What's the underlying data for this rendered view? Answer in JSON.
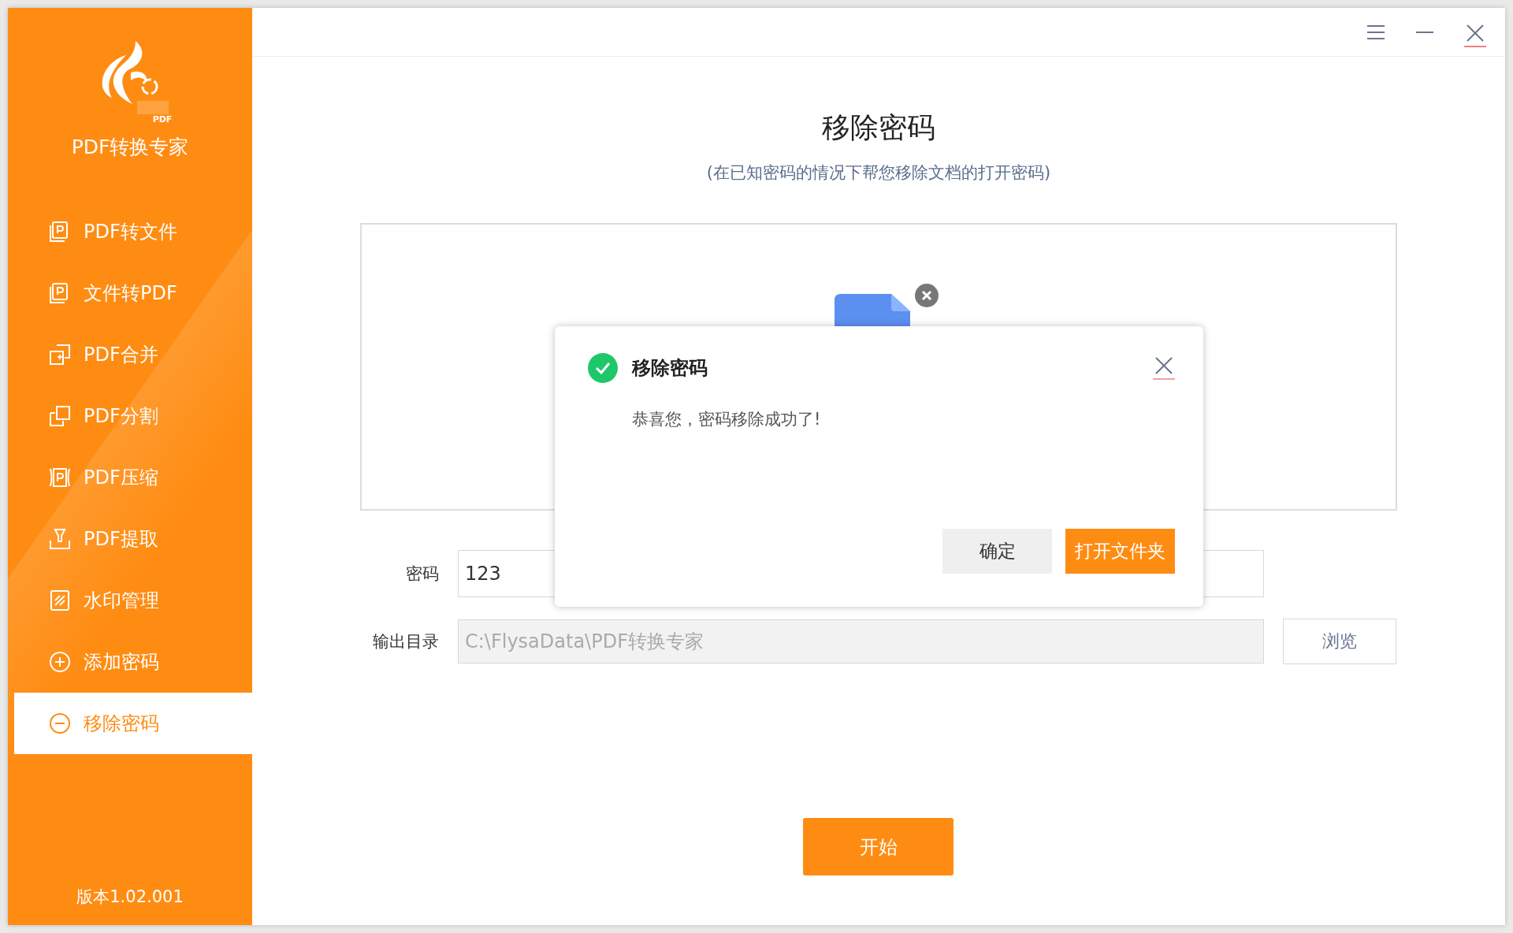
{
  "app": {
    "name": "PDF转换专家",
    "logo_badge": "PDF",
    "version": "版本1.02.001"
  },
  "sidebar": {
    "items": [
      {
        "label": "PDF转文件",
        "kind": "document",
        "selected": false
      },
      {
        "label": "文件转PDF",
        "kind": "document",
        "selected": false
      },
      {
        "label": "PDF合并",
        "kind": "merge",
        "selected": false
      },
      {
        "label": "PDF分割",
        "kind": "split",
        "selected": false
      },
      {
        "label": "PDF压缩",
        "kind": "compress",
        "selected": false
      },
      {
        "label": "PDF提取",
        "kind": "extract",
        "selected": false
      },
      {
        "label": "水印管理",
        "kind": "watermark",
        "selected": false
      },
      {
        "label": "添加密码",
        "kind": "plus",
        "selected": false
      },
      {
        "label": "移除密码",
        "kind": "minus",
        "selected": true
      }
    ]
  },
  "page": {
    "title": "移除密码",
    "subtitle": "(在已知密码的情况下帮您移除文档的打开密码)"
  },
  "form": {
    "password": {
      "label": "密码",
      "value": "123"
    },
    "output": {
      "label": "输出目录",
      "value": "C:\\FlysaData\\PDF转换专家",
      "disabled": true
    },
    "browse_button": "浏览"
  },
  "start_button": "开始",
  "dialog": {
    "title": "移除密码",
    "message": "恭喜您，密码移除成功了!",
    "buttons": [
      {
        "label": "确定",
        "kind": "secondary"
      },
      {
        "label": "打开文件夹",
        "kind": "primary"
      }
    ]
  }
}
